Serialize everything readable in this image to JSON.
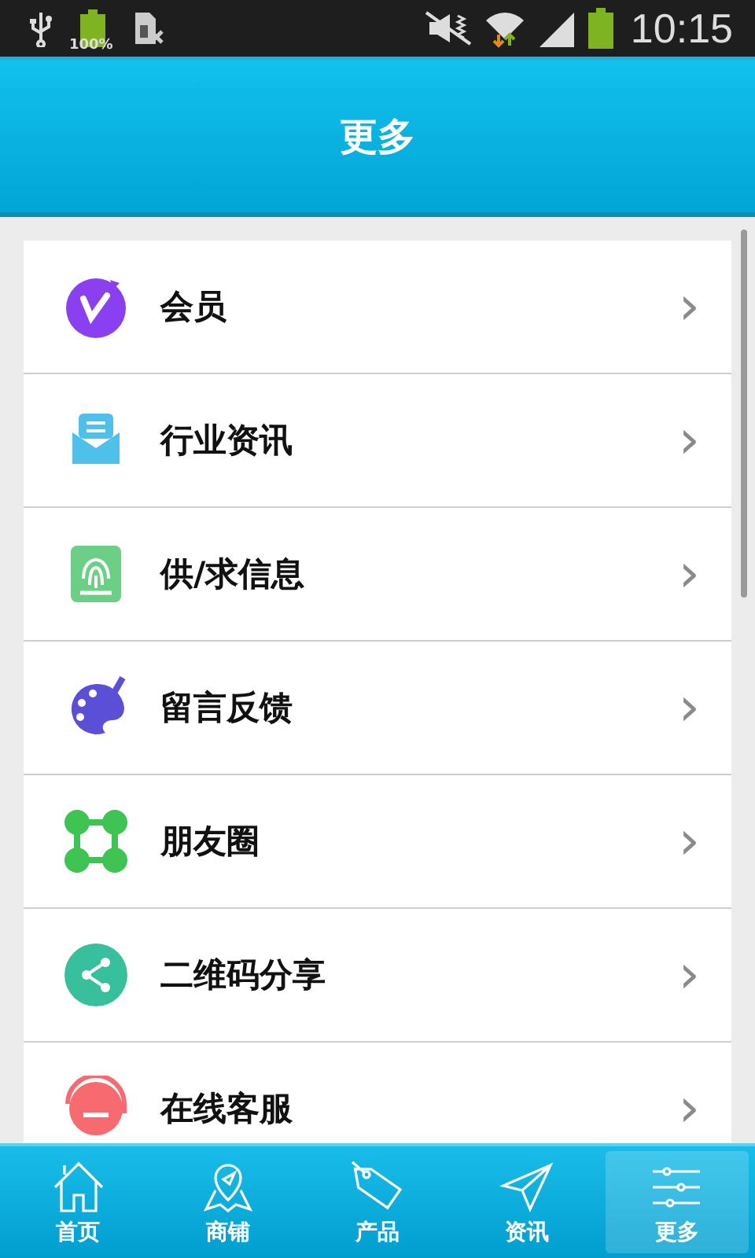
{
  "status_bar": {
    "battery_label": "100%",
    "time": "10:15"
  },
  "header": {
    "title": "更多"
  },
  "menu": [
    {
      "label": "会员",
      "chevron": "›"
    },
    {
      "label": "行业资讯",
      "chevron": "›"
    },
    {
      "label": "供/求信息",
      "chevron": "›"
    },
    {
      "label": "留言反馈",
      "chevron": "›"
    },
    {
      "label": "朋友圈",
      "chevron": "›"
    },
    {
      "label": "二维码分享",
      "chevron": "›"
    },
    {
      "label": "在线客服",
      "chevron": "›"
    }
  ],
  "tab_bar": [
    {
      "label": "首页",
      "selected": false
    },
    {
      "label": "商铺",
      "selected": false
    },
    {
      "label": "产品",
      "selected": false
    },
    {
      "label": "资讯",
      "selected": false
    },
    {
      "label": "更多",
      "selected": true
    }
  ]
}
